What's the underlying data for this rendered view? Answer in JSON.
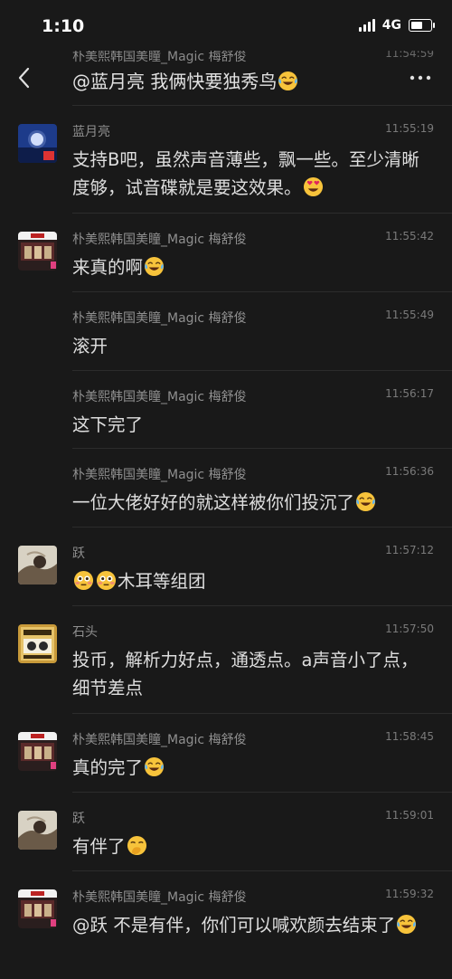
{
  "status": {
    "time": "1:10",
    "network": "4G"
  },
  "nav": {
    "peek_sender": "朴美熙韩国美瞳_Magic 梅舒俊",
    "peek_time": "11:54:59",
    "peek_message": "@蓝月亮 我俩快要独秀鸟"
  },
  "messages": [
    {
      "sender": "蓝月亮",
      "time": "11:55:19",
      "avatar": "moon-avatar",
      "text": "支持B吧，虽然声音薄些，飘一些。至少清晰度够，试音碟就是要这效果。",
      "emoji": "heart-eyes-emoji"
    },
    {
      "sender": "朴美熙韩国美瞳_Magic 梅舒俊",
      "time": "11:55:42",
      "avatar": "shop-avatar",
      "text": "来真的啊",
      "emoji": "tears-of-joy-emoji"
    },
    {
      "sender": "朴美熙韩国美瞳_Magic 梅舒俊",
      "time": "11:55:49",
      "avatar": "",
      "text": "滚开",
      "emoji": ""
    },
    {
      "sender": "朴美熙韩国美瞳_Magic 梅舒俊",
      "time": "11:56:17",
      "avatar": "",
      "text": "这下完了",
      "emoji": ""
    },
    {
      "sender": "朴美熙韩国美瞳_Magic 梅舒俊",
      "time": "11:56:36",
      "avatar": "",
      "text": "一位大佬好好的就这样被你们投沉了",
      "emoji": "tears-of-joy-emoji"
    },
    {
      "sender": "跃",
      "time": "11:57:12",
      "avatar": "photo-avatar",
      "text": "木耳等组团",
      "emoji_prefix": "flushed-emoji"
    },
    {
      "sender": "石头",
      "time": "11:57:50",
      "avatar": "gold-avatar",
      "text": "投币，解析力好点，通透点。a声音小了点，细节差点",
      "emoji": ""
    },
    {
      "sender": "朴美熙韩国美瞳_Magic 梅舒俊",
      "time": "11:58:45",
      "avatar": "shop-avatar",
      "text": "真的完了",
      "emoji": "tears-of-joy-emoji"
    },
    {
      "sender": "跃",
      "time": "11:59:01",
      "avatar": "photo-avatar",
      "text": "有伴了",
      "emoji": "hand-over-mouth-emoji"
    },
    {
      "sender": "朴美熙韩国美瞳_Magic 梅舒俊",
      "time": "11:59:32",
      "avatar": "shop-avatar",
      "text": "@跃 不是有伴，你们可以喊欢颜去结束了",
      "emoji": "tears-of-joy-emoji"
    }
  ]
}
